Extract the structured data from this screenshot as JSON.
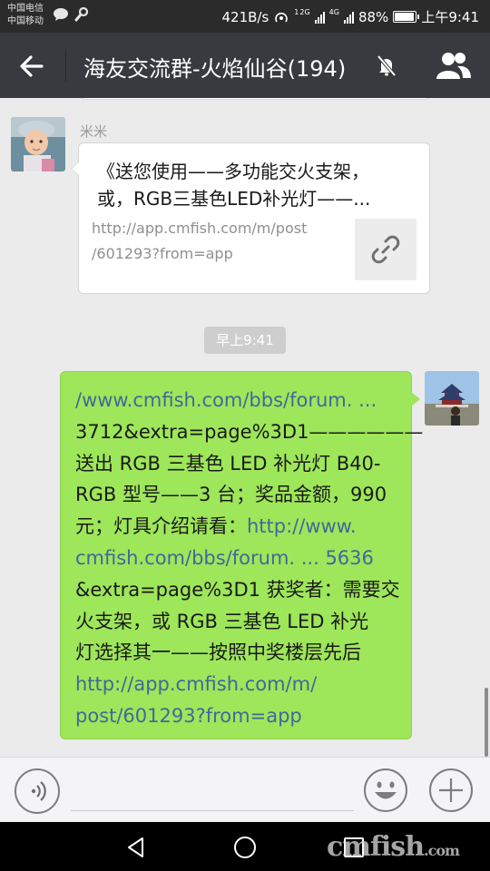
{
  "status_bar": {
    "carrier_1": "中国电信",
    "carrier_2": "中国移动",
    "net_speed": "421B/s",
    "net_1": "1",
    "net_2": "2G",
    "net_3": "4G",
    "battery": "88%",
    "time": "上午9:41"
  },
  "header": {
    "title": "海友交流群-火焰仙谷(194)",
    "back_icon": "arrow-left-icon",
    "mute_icon": "bell-off-icon",
    "members_icon": "group-icon"
  },
  "messages": [
    {
      "sender": "米米",
      "type": "link-card",
      "title_lines": [
        "《送您使用——多功能交火支架，",
        "或，RGB三基色LED补光灯——..."
      ],
      "url_lines": [
        "http://app.cmfish.com/m/post",
        "/601293?from=app"
      ],
      "thumb_icon": "link-icon"
    }
  ],
  "timestamp": "早上9:41",
  "my_message": {
    "segments": [
      {
        "text": "/www.cmfish.com/bbs/forum. ...",
        "link": true
      },
      {
        "text": "3712&extra=page%3D1——————",
        "link": false
      },
      {
        "text": "送出 RGB 三基色 LED 补光灯 B40-",
        "link": false
      },
      {
        "text": "RGB 型号——3 台；奖品金额，990",
        "link": false
      },
      {
        "text": "元；灯具介绍请看：",
        "link": false
      },
      {
        "text": "http://www.",
        "link": true
      },
      {
        "text": "cmfish.com/bbs/forum. ... 5636",
        "link": true
      },
      {
        "text": "&extra=page%3D1 获奖者：需要交",
        "link": false
      },
      {
        "text": "火支架，或 RGB 三基色 LED 补光",
        "link": false
      },
      {
        "text": "灯选择其一——按照中奖楼层先后",
        "link": false
      },
      {
        "text": "http://app.cmfish.com/m/",
        "link": true
      },
      {
        "text": "post/601293?from=app",
        "link": true
      }
    ]
  },
  "input_bar": {
    "voice_icon": "voice-icon",
    "emoji_icon": "emoji-icon",
    "plus_icon": "plus-icon"
  },
  "nav_bar": {
    "back_icon": "triangle-back-icon",
    "home_icon": "circle-home-icon",
    "recent_icon": "square-recent-icon"
  },
  "watermark": {
    "main": "cmfish",
    "suffix": ".com"
  },
  "colors": {
    "titlebar": "#393a3f",
    "sent_bubble": "#9ee65a",
    "link": "#43689a"
  }
}
